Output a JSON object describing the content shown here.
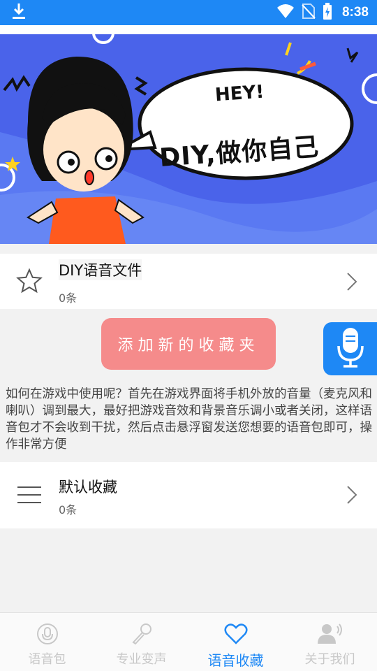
{
  "status_bar": {
    "time": "8:38"
  },
  "banner": {
    "hey_text": "HEY!",
    "slogan": "DIY,做你自己"
  },
  "diy_card": {
    "title": "DIY语音文件",
    "count": "0条"
  },
  "add_folder_button": "添加新的收藏夹",
  "help_text": "如何在游戏中使用呢？首先在游戏界面将手机外放的音量（麦克风和喇叭）调到最大，最好把游戏音效和背景音乐调小或者关闭，这样语音包才不会收到干扰，然后点击悬浮窗发送您想要的语音包即可，操作非常方便",
  "default_card": {
    "title": "默认收藏",
    "count": "0条"
  },
  "bottom_nav": {
    "items": [
      {
        "label": "语音包",
        "icon": "mic-circle-icon"
      },
      {
        "label": "专业变声",
        "icon": "microphone-icon"
      },
      {
        "label": "语音收藏",
        "icon": "heart-icon"
      },
      {
        "label": "关于我们",
        "icon": "user-signal-icon"
      }
    ],
    "active_index": 2
  },
  "colors": {
    "primary": "#1e88f5",
    "add_button": "#f58b8b",
    "banner_bg": "#4a63ea"
  }
}
